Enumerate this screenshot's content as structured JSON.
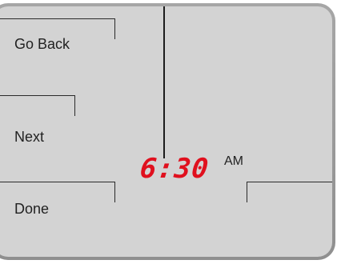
{
  "buttons": {
    "go_back": "Go Back",
    "next": "Next",
    "done": "Done"
  },
  "clock": {
    "time": "6:30",
    "period": "AM",
    "color": "#e0101e"
  }
}
